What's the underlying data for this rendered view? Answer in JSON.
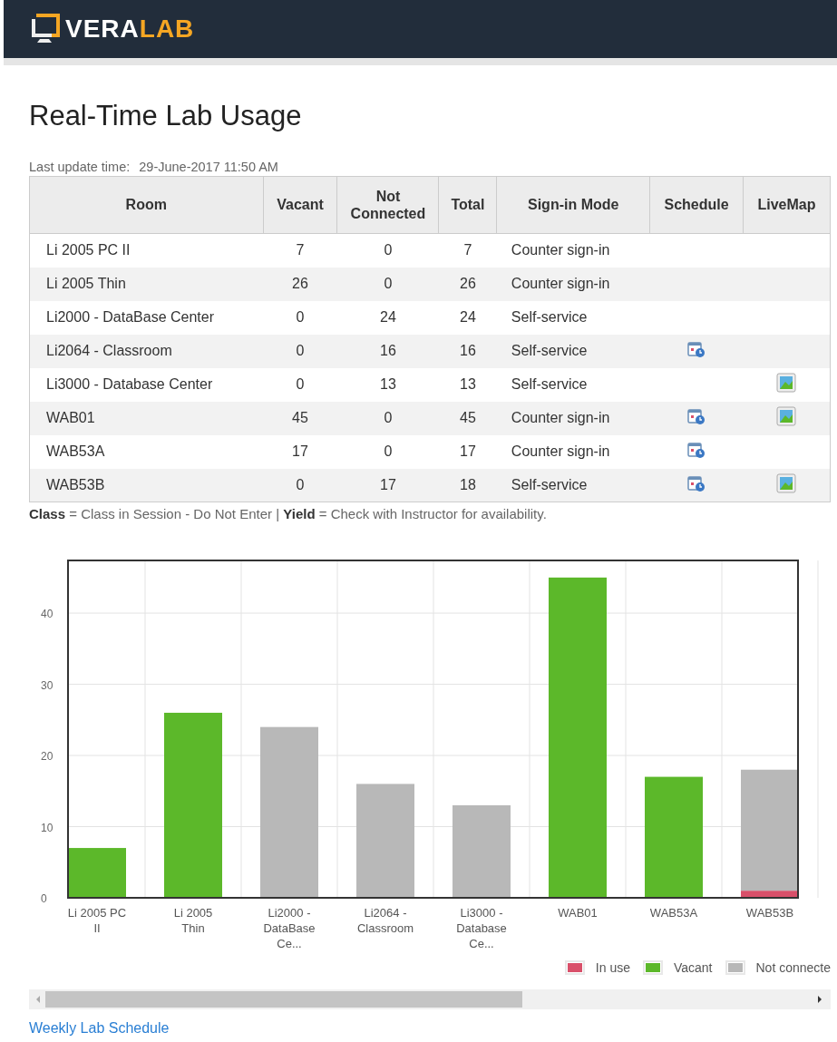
{
  "header": {
    "logo": {
      "part_1": "VERA",
      "part_2": "LAB"
    }
  },
  "title": "Real-Time Lab Usage",
  "last_update": {
    "label": "Last update time:",
    "value": "29-June-2017 11:50 AM"
  },
  "table": {
    "columns": [
      "Room",
      "Vacant",
      "Not Connected",
      "Total",
      "Sign-in Mode",
      "Schedule",
      "LiveMap"
    ],
    "rows": [
      {
        "room": "Li 2005 PC II",
        "vacant": "7",
        "not_connected": "0",
        "total": "7",
        "mode": "Counter sign-in",
        "schedule": false,
        "livemap": false
      },
      {
        "room": "Li 2005 Thin",
        "vacant": "26",
        "not_connected": "0",
        "total": "26",
        "mode": "Counter sign-in",
        "schedule": false,
        "livemap": false
      },
      {
        "room": "Li2000 - DataBase Center",
        "vacant": "0",
        "not_connected": "24",
        "total": "24",
        "mode": "Self-service",
        "schedule": false,
        "livemap": false
      },
      {
        "room": "Li2064 - Classroom",
        "vacant": "0",
        "not_connected": "16",
        "total": "16",
        "mode": "Self-service",
        "schedule": true,
        "livemap": false
      },
      {
        "room": "Li3000 - Database Center",
        "vacant": "0",
        "not_connected": "13",
        "total": "13",
        "mode": "Self-service",
        "schedule": false,
        "livemap": true
      },
      {
        "room": "WAB01",
        "vacant": "45",
        "not_connected": "0",
        "total": "45",
        "mode": "Counter sign-in",
        "schedule": true,
        "livemap": true
      },
      {
        "room": "WAB53A",
        "vacant": "17",
        "not_connected": "0",
        "total": "17",
        "mode": "Counter sign-in",
        "schedule": true,
        "livemap": false
      },
      {
        "room": "WAB53B",
        "vacant": "0",
        "not_connected": "17",
        "total": "18",
        "mode": "Self-service",
        "schedule": true,
        "livemap": true
      }
    ]
  },
  "legend_note": "**Class** = Class in Session - Do Not Enter | **Yield** = Check with Instructor for availability.",
  "chart_data": {
    "type": "bar",
    "stacked": true,
    "categories": [
      "Li 2005 PC II",
      "Li 2005 Thin",
      "Li2000 - DataBase Ce...",
      "Li2064 - Classroom",
      "Li3000 - Database Ce...",
      "WAB01",
      "WAB53A",
      "WAB53B"
    ],
    "series": [
      {
        "name": "In use",
        "color": "#d9506a",
        "values": [
          0,
          0,
          0,
          0,
          0,
          0,
          0,
          1
        ]
      },
      {
        "name": "Vacant",
        "color": "#5cb82a",
        "values": [
          7,
          26,
          0,
          0,
          0,
          45,
          17,
          0
        ]
      },
      {
        "name": "Not connecte",
        "color": "#b8b8b8",
        "values": [
          0,
          0,
          24,
          16,
          13,
          0,
          0,
          17
        ]
      }
    ],
    "grid": true,
    "ylim": [
      0,
      47.4
    ],
    "yticks": [
      0,
      10,
      20,
      30,
      40
    ]
  },
  "link": "Weekly Lab Schedule"
}
